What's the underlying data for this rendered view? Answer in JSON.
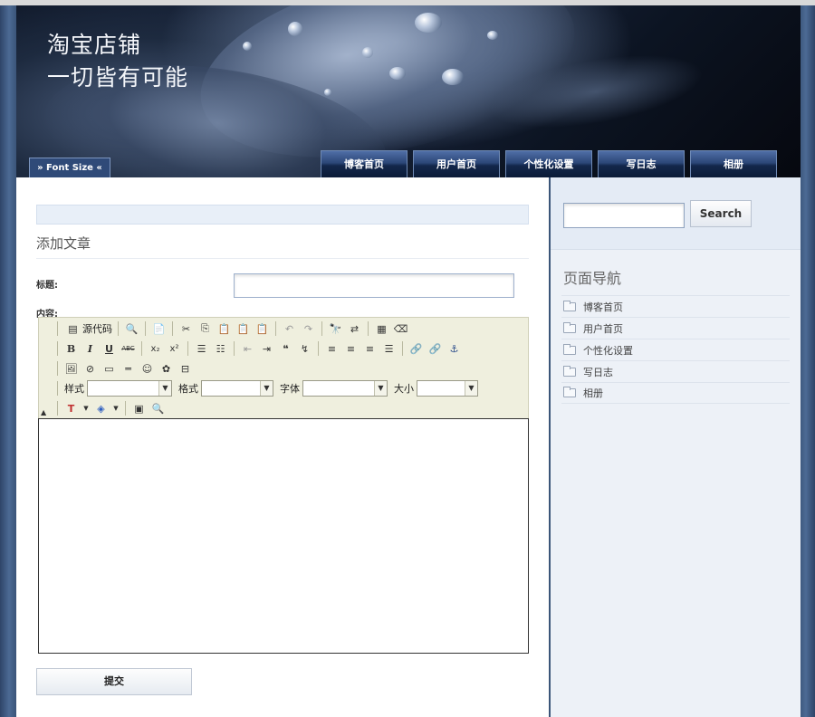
{
  "header": {
    "title_line1": "淘宝店铺",
    "title_line2": "一切皆有可能",
    "font_size_label": "» Font Size «",
    "nav": [
      "博客首页",
      "用户首页",
      "个性化设置",
      "写日志",
      "相册"
    ]
  },
  "form": {
    "page_title": "添加文章",
    "title_label": "标题:",
    "title_value": "",
    "content_label": "内容:",
    "submit_label": "提交"
  },
  "editor": {
    "source_label": "源代码",
    "style_label": "样式",
    "format_label": "格式",
    "font_label": "字体",
    "size_label": "大小",
    "style_value": "",
    "format_value": "",
    "font_value": "",
    "size_value": "",
    "content": ""
  },
  "sidebar": {
    "search_value": "",
    "search_button": "Search",
    "nav_heading": "页面导航",
    "items": [
      "博客首页",
      "用户首页",
      "个性化设置",
      "写日志",
      "相册"
    ]
  },
  "colors": {
    "frame": "#3a5276",
    "nav_tab": "#1f3661",
    "toolbar_bg": "#efefde",
    "sidebar_bg": "#edf1f7"
  }
}
